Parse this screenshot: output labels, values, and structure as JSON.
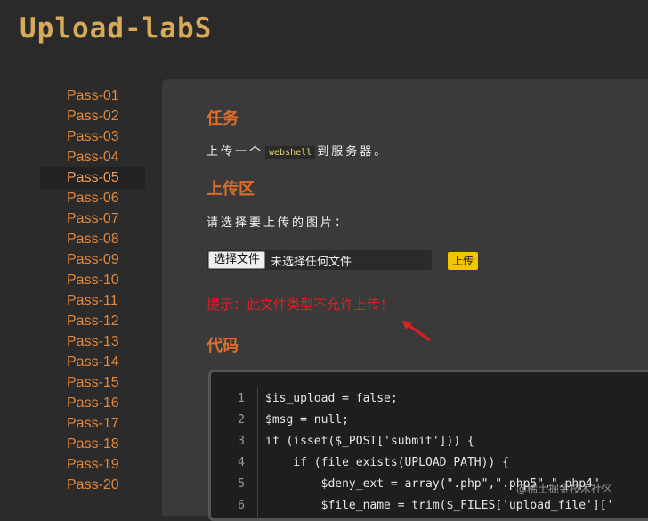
{
  "header": {
    "logo_text": "Upload-labS"
  },
  "sidebar": {
    "items": [
      {
        "label": "Pass-01"
      },
      {
        "label": "Pass-02"
      },
      {
        "label": "Pass-03"
      },
      {
        "label": "Pass-04"
      },
      {
        "label": "Pass-05"
      },
      {
        "label": "Pass-06"
      },
      {
        "label": "Pass-07"
      },
      {
        "label": "Pass-08"
      },
      {
        "label": "Pass-09"
      },
      {
        "label": "Pass-10"
      },
      {
        "label": "Pass-11"
      },
      {
        "label": "Pass-12"
      },
      {
        "label": "Pass-13"
      },
      {
        "label": "Pass-14"
      },
      {
        "label": "Pass-15"
      },
      {
        "label": "Pass-16"
      },
      {
        "label": "Pass-17"
      },
      {
        "label": "Pass-18"
      },
      {
        "label": "Pass-19"
      },
      {
        "label": "Pass-20"
      }
    ],
    "active_index": 4
  },
  "task": {
    "heading": "任务",
    "text_before": "上传一个",
    "code": "webshell",
    "text_after": "到服务器。"
  },
  "upload": {
    "heading": "上传区",
    "prompt": "请选择要上传的图片：",
    "file_button": "选择文件",
    "file_status": "未选择任何文件",
    "submit": "上传",
    "hint": "提示：此文件类型不允许上传！"
  },
  "code_section": {
    "heading": "代码",
    "line_numbers": [
      "1",
      "2",
      "3",
      "4",
      "5",
      "6"
    ],
    "lines": [
      "$is_upload = false;",
      "$msg = null;",
      "if (isset($_POST['submit'])) {",
      "    if (file_exists(UPLOAD_PATH)) {",
      "        $deny_ext = array(\".php\",\".php5\",\".php4\",",
      "        $file_name = trim($_FILES['upload_file']['"
    ]
  },
  "watermark": "@稀土掘金技术社区",
  "colors": {
    "accent_orange": "#e06c2c",
    "nav_text": "#e6883a",
    "logo": "#d6aa5a",
    "hint_red": "#e02020",
    "upload_button": "#f5c400"
  }
}
